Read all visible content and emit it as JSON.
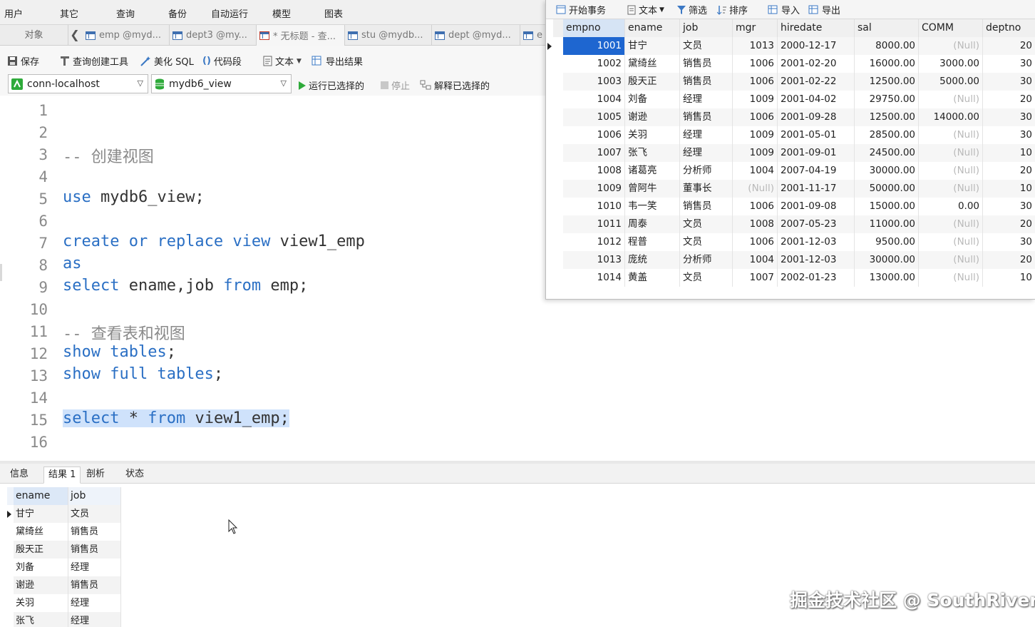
{
  "menu": [
    "用户",
    "其它",
    "查询",
    "备份",
    "自动运行",
    "模型",
    "图表"
  ],
  "tabs": {
    "objects": "对象",
    "items": [
      "emp @myd...",
      "dept3 @my...",
      "* 无标题 - 查...",
      "stu @mydb...",
      "dept @myd...",
      "e"
    ]
  },
  "toolbar": {
    "save": "保存",
    "query_builder": "查询创建工具",
    "beautify": "美化 SQL",
    "snippet": "代码段",
    "text": "文本",
    "export": "导出结果"
  },
  "conn": {
    "connection": "conn-localhost",
    "database": "mydb6_view",
    "run_selected": "运行已选择的",
    "stop": "停止",
    "explain": "解释已选择的"
  },
  "editor": {
    "line_numbers": [
      "1",
      "2",
      "3",
      "4",
      "5",
      "6",
      "7",
      "8",
      "9",
      "10",
      "11",
      "12",
      "13",
      "14",
      "15",
      "16"
    ],
    "comment1": "-- 创建视图",
    "use_kw": "use",
    "use_rest": " mydb6_view;",
    "create_kw": "create or replace view",
    "create_rest": " view1_emp",
    "as_kw": "as",
    "select_kw": "select",
    "select_mid": " ename,job ",
    "from_kw": "from",
    "select_end": " emp;",
    "comment2": "-- 查看表和视图",
    "show_kw1": "show tables",
    "show_end1": ";",
    "show_kw2": "show full tables",
    "show_end2": ";",
    "sel2_kw": "select",
    "sel2_mid": " * ",
    "sel2_from": "from",
    "sel2_end": " view1_emp;"
  },
  "result_tabs": [
    "信息",
    "结果 1",
    "剖析",
    "状态"
  ],
  "result": {
    "columns": [
      "ename",
      "job"
    ],
    "rows": [
      [
        "甘宁",
        "文员"
      ],
      [
        "黛绮丝",
        "销售员"
      ],
      [
        "殷天正",
        "销售员"
      ],
      [
        "刘备",
        "经理"
      ],
      [
        "谢逊",
        "销售员"
      ],
      [
        "关羽",
        "经理"
      ],
      [
        "张飞",
        "经理"
      ]
    ]
  },
  "float_toolbar": {
    "begin_tx": "开始事务",
    "text": "文本",
    "filter": "筛选",
    "sort": "排序",
    "import": "导入",
    "export": "导出"
  },
  "emp_table": {
    "columns": [
      "empno",
      "ename",
      "job",
      "mgr",
      "hiredate",
      "sal",
      "COMM",
      "deptno"
    ],
    "rows": [
      [
        "1001",
        "甘宁",
        "文员",
        "1013",
        "2000-12-17",
        "8000.00",
        "(Null)",
        "20"
      ],
      [
        "1002",
        "黛绮丝",
        "销售员",
        "1006",
        "2001-02-20",
        "16000.00",
        "3000.00",
        "30"
      ],
      [
        "1003",
        "殷天正",
        "销售员",
        "1006",
        "2001-02-22",
        "12500.00",
        "5000.00",
        "30"
      ],
      [
        "1004",
        "刘备",
        "经理",
        "1009",
        "2001-04-02",
        "29750.00",
        "(Null)",
        "20"
      ],
      [
        "1005",
        "谢逊",
        "销售员",
        "1006",
        "2001-09-28",
        "12500.00",
        "14000.00",
        "30"
      ],
      [
        "1006",
        "关羽",
        "经理",
        "1009",
        "2001-05-01",
        "28500.00",
        "(Null)",
        "30"
      ],
      [
        "1007",
        "张飞",
        "经理",
        "1009",
        "2001-09-01",
        "24500.00",
        "(Null)",
        "10"
      ],
      [
        "1008",
        "诸葛亮",
        "分析师",
        "1004",
        "2007-04-19",
        "30000.00",
        "(Null)",
        "20"
      ],
      [
        "1009",
        "曾阿牛",
        "董事长",
        "(Null)",
        "2001-11-17",
        "50000.00",
        "(Null)",
        "10"
      ],
      [
        "1010",
        "韦一笑",
        "销售员",
        "1006",
        "2001-09-08",
        "15000.00",
        "0.00",
        "30"
      ],
      [
        "1011",
        "周泰",
        "文员",
        "1008",
        "2007-05-23",
        "11000.00",
        "(Null)",
        "20"
      ],
      [
        "1012",
        "程普",
        "文员",
        "1006",
        "2001-12-03",
        "9500.00",
        "(Null)",
        "30"
      ],
      [
        "1013",
        "庞统",
        "分析师",
        "1004",
        "2001-12-03",
        "30000.00",
        "(Null)",
        "20"
      ],
      [
        "1014",
        "黄盖",
        "文员",
        "1007",
        "2002-01-23",
        "13000.00",
        "(Null)",
        "10"
      ]
    ]
  },
  "watermark": "掘金技术社区 @ SouthRiver",
  "colors": {
    "keyword": "#2a6fc4",
    "comment": "#8a8a8a",
    "selection": "#cfe2fb",
    "selected_cell": "#1e66d0",
    "run_green": "#2eaa3a"
  }
}
